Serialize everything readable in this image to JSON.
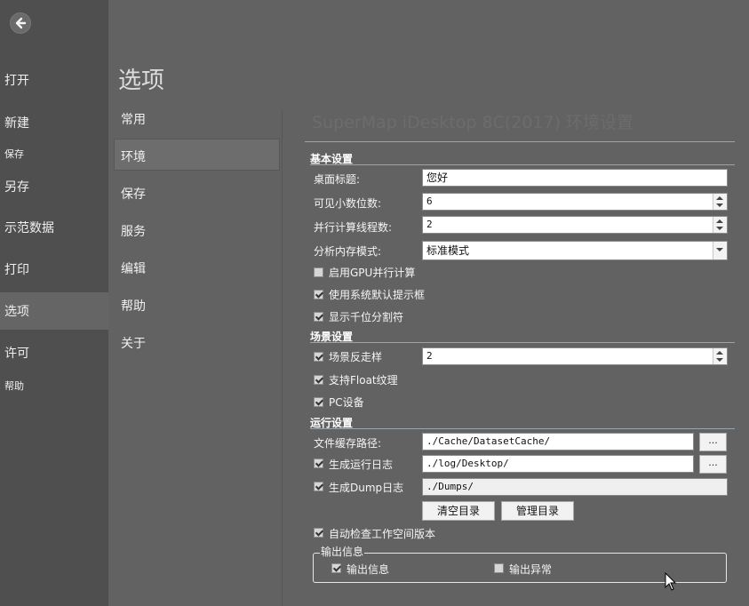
{
  "nav": {
    "items": [
      "打开",
      "新建",
      "保存",
      "另存",
      "示范数据",
      "打印",
      "选项",
      "许可",
      "帮助"
    ],
    "selected": "选项"
  },
  "options": {
    "title": "选项",
    "items": [
      "常用",
      "环境",
      "保存",
      "服务",
      "编辑",
      "帮助",
      "关于"
    ],
    "selected": "环境"
  },
  "content": {
    "heading": "SuperMap iDesktop 8C(2017) 环境设置",
    "basic": {
      "title": "基本设置",
      "desktop_title_label": "桌面标题:",
      "desktop_title_value": "您好",
      "decimals_label": "可见小数位数:",
      "decimals_value": "6",
      "threads_label": "并行计算线程数:",
      "threads_value": "2",
      "memory_mode_label": "分析内存模式:",
      "memory_mode_value": "标准模式",
      "gpu_label": "启用GPU并行计算",
      "gpu_checked": false,
      "sys_prompt_label": "使用系统默认提示框",
      "sys_prompt_checked": true,
      "thousands_label": "显示千位分割符",
      "thousands_checked": true
    },
    "scene": {
      "title": "场景设置",
      "antialias_label": "场景反走样",
      "antialias_checked": true,
      "antialias_value": "2",
      "float_label": "支持Float纹理",
      "float_checked": true,
      "pc_label": "PC设备",
      "pc_checked": true
    },
    "runtime": {
      "title": "运行设置",
      "cache_label": "文件缓存路径:",
      "cache_value": "./Cache/DatasetCache/",
      "log_label": "生成运行日志",
      "log_checked": true,
      "log_value": "./log/Desktop/",
      "dump_label": "生成Dump日志",
      "dump_checked": true,
      "dump_value": "./Dumps/",
      "browse_label": "...",
      "clear_btn": "清空目录",
      "manage_btn": "管理目录",
      "auto_check_label": "自动检查工作空间版本",
      "auto_check_checked": true
    },
    "output": {
      "group_title": "输出信息",
      "info_label": "输出信息",
      "info_checked": true,
      "error_label": "输出异常",
      "error_checked": false
    }
  },
  "colors": {
    "left_nav_bg": "#4f4f4f",
    "main_bg": "#626262",
    "separator": "#9aa4b0"
  }
}
